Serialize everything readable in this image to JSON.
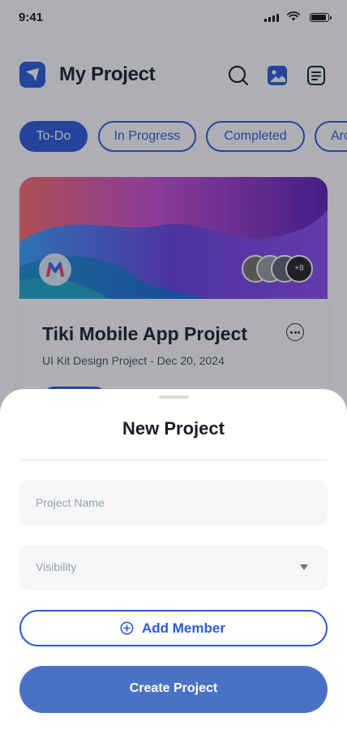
{
  "status_bar": {
    "time": "9:41"
  },
  "header": {
    "app_title": "My Project"
  },
  "tabs": [
    {
      "label": "To-Do",
      "active": true
    },
    {
      "label": "In Progress",
      "active": false
    },
    {
      "label": "Completed",
      "active": false
    },
    {
      "label": "Archived",
      "active": false
    }
  ],
  "project_card": {
    "title": "Tiki Mobile App Project",
    "subtitle": "UI Kit Design Project - Dec 20, 2024",
    "extra_members": "+8"
  },
  "sheet": {
    "title": "New Project",
    "project_name_placeholder": "Project Name",
    "visibility_placeholder": "Visibility",
    "add_member_label": "Add Member",
    "create_label": "Create Project"
  },
  "colors": {
    "primary": "#2a5ad8",
    "create_button": "#4a72c4",
    "field_bg": "#f5f6f8"
  },
  "icons": [
    "app-logo-icon",
    "search-icon",
    "gallery-icon",
    "document-icon",
    "more-icon",
    "chevron-down-icon",
    "add-circle-icon"
  ]
}
